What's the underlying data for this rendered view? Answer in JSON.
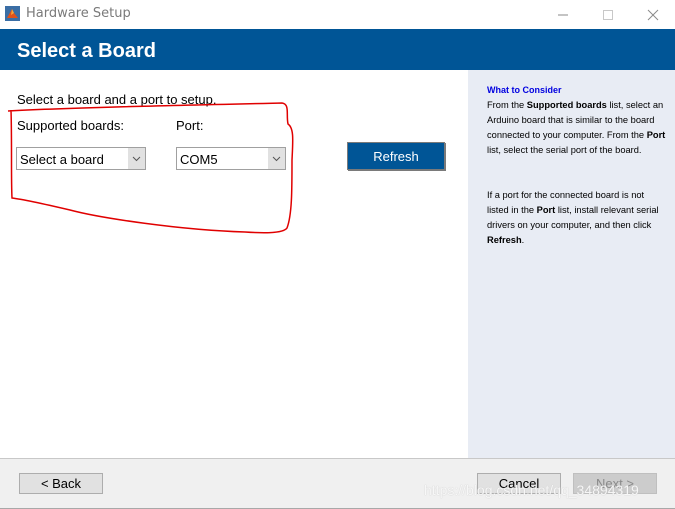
{
  "window": {
    "title": "Hardware Setup",
    "icon": "matlab-icon",
    "controls": [
      "minimize",
      "maximize",
      "close"
    ]
  },
  "header": {
    "title": "Select a Board"
  },
  "main": {
    "intro": "Select a board and a port to setup.",
    "boards_label": "Supported boards:",
    "boards_value": "Select a board",
    "port_label": "Port:",
    "port_value": "COM5",
    "refresh_label": "Refresh"
  },
  "side": {
    "heading": "What to Consider",
    "p1": [
      {
        "t": "From the ",
        "b": false
      },
      {
        "t": "Supported boards",
        "b": true
      },
      {
        "t": " list, select an Arduino board that is similar to the board connected to your computer. From the ",
        "b": false
      },
      {
        "t": "Port",
        "b": true
      },
      {
        "t": " list, select the serial port of the board.",
        "b": false
      }
    ],
    "p2": [
      {
        "t": "If a port for the connected board is not listed in the ",
        "b": false
      },
      {
        "t": "Port",
        "b": true
      },
      {
        "t": " list, install relevant serial drivers on your computer, and then click ",
        "b": false
      },
      {
        "t": "Refresh",
        "b": true
      },
      {
        "t": ".",
        "b": false
      }
    ]
  },
  "footer": {
    "back_label": "< Back",
    "cancel_label": "Cancel",
    "next_label": "Next >"
  },
  "watermark": "https://blog.csdn.net/qq_34894319",
  "colors": {
    "header_bg": "#005596",
    "side_bg": "#e8ecf4",
    "heading_blue": "#0000e0",
    "annotation_red": "#e00000"
  }
}
